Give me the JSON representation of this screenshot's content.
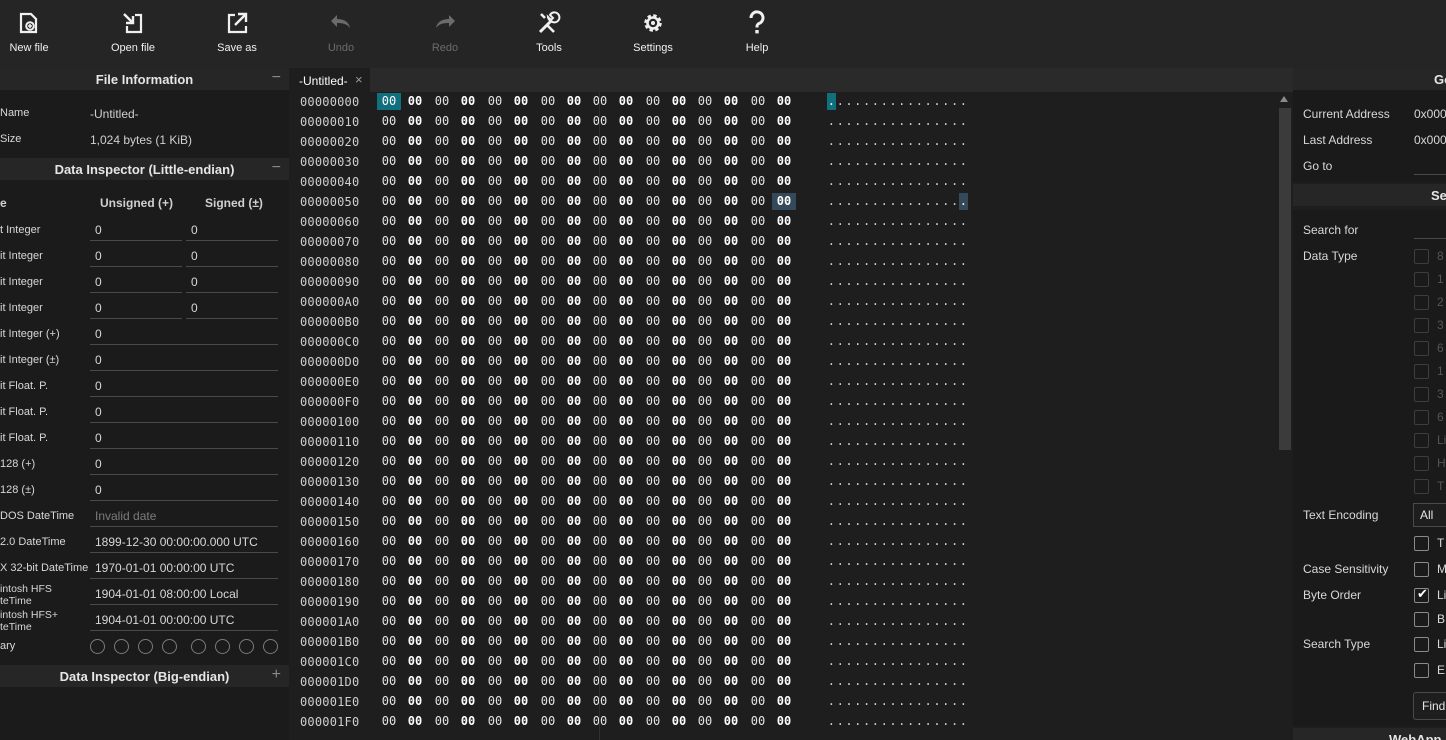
{
  "toolbar": {
    "new_file": "New file",
    "open_file": "Open file",
    "save_as": "Save as",
    "undo": "Undo",
    "redo": "Redo",
    "tools": "Tools",
    "settings": "Settings",
    "help": "Help"
  },
  "file_info": {
    "title": "File Information",
    "toggle": "−",
    "name_label": "Name",
    "name_value": "-Untitled-",
    "size_label": "Size",
    "size_value": "1,024 bytes (1 KiB)"
  },
  "inspector_le": {
    "title": "Data Inspector (Little-endian)",
    "toggle": "−",
    "col_type": "e",
    "col_unsigned": "Unsigned (+)",
    "col_signed": "Signed (±)",
    "rows": [
      {
        "label": "t Integer",
        "unsigned": "0",
        "signed": "0"
      },
      {
        "label": "it Integer",
        "unsigned": "0",
        "signed": "0"
      },
      {
        "label": "it Integer",
        "unsigned": "0",
        "signed": "0"
      },
      {
        "label": "it Integer",
        "unsigned": "0",
        "signed": "0"
      }
    ],
    "wide_rows": [
      {
        "label": "it Integer (+)",
        "value": "0"
      },
      {
        "label": "it Integer (±)",
        "value": "0"
      },
      {
        "label": "it Float. P.",
        "value": "0"
      },
      {
        "label": "it Float. P.",
        "value": "0"
      },
      {
        "label": "it Float. P.",
        "value": "0"
      },
      {
        "label": "128 (+)",
        "value": "0"
      },
      {
        "label": "128 (±)",
        "value": "0"
      },
      {
        "label": "DOS DateTime",
        "value": "Invalid date"
      },
      {
        "label": "2.0 DateTime",
        "value": "1899-12-30 00:00:00.000 UTC"
      },
      {
        "label": "X 32-bit DateTime",
        "value": "1970-01-01 00:00:00 UTC"
      },
      {
        "label": "intosh HFS",
        "label2": "teTime",
        "value": "1904-01-01 08:00:00 Local"
      },
      {
        "label": "intosh HFS+",
        "label2": "teTime",
        "value": "1904-01-01 00:00:00 UTC"
      }
    ],
    "binary_label": "ary"
  },
  "inspector_be": {
    "title": "Data Inspector (Big-endian)",
    "toggle": "+"
  },
  "tab": {
    "name": "-Untitled-",
    "close": "×"
  },
  "hex": {
    "addresses": [
      "00000000",
      "00000010",
      "00000020",
      "00000030",
      "00000040",
      "00000050",
      "00000060",
      "00000070",
      "00000080",
      "00000090",
      "000000A0",
      "000000B0",
      "000000C0",
      "000000D0",
      "000000E0",
      "000000F0",
      "00000100",
      "00000110",
      "00000120",
      "00000130",
      "00000140",
      "00000150",
      "00000160",
      "00000170",
      "00000180",
      "00000190",
      "000001A0",
      "000001B0",
      "000001C0",
      "000001D0",
      "000001E0",
      "000001F0"
    ],
    "byte_value": "00",
    "ascii_char": ".",
    "selected": {
      "row": 0,
      "col": 0
    },
    "hovered": {
      "row": 5,
      "col": 15
    }
  },
  "goto": {
    "title": "Go",
    "current_label": "Current Address",
    "current_value": "0x000",
    "last_label": "Last Address",
    "last_value": "0x000",
    "goto_label": "Go to"
  },
  "search": {
    "title": "Se",
    "search_for": "Search for",
    "data_type": "Data Type",
    "data_type_options": [
      "8",
      "1",
      "2",
      "3",
      "6",
      "1",
      "3",
      "6",
      "Li",
      "H",
      "T"
    ],
    "text_encoding": "Text Encoding",
    "encoding_value": "All",
    "encoding_opt": "T",
    "case_sensitivity": "Case Sensitivity",
    "case_opt": "M",
    "byte_order": "Byte Order",
    "byte_order_opts": [
      "Li",
      "B"
    ],
    "search_type": "Search Type",
    "search_type_opts": [
      "Li",
      "E"
    ],
    "find_button": "Find"
  },
  "webapp": {
    "title": "WebApp"
  }
}
